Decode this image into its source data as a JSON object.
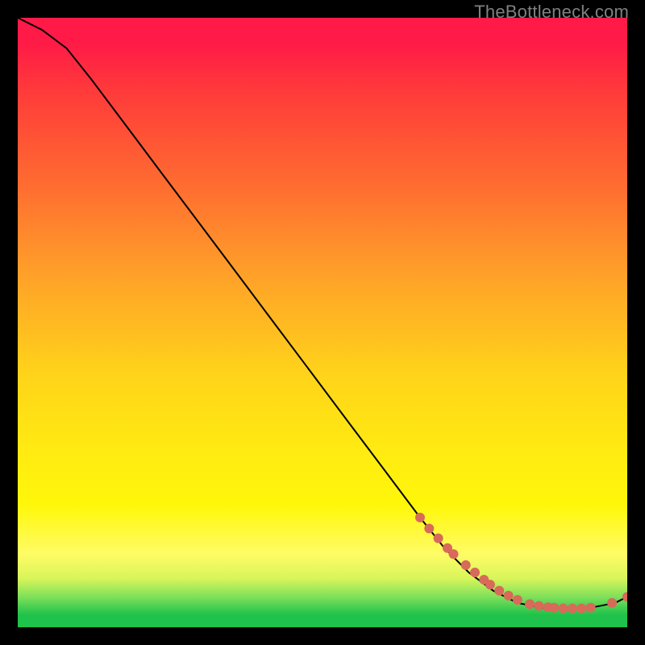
{
  "watermark": "TheBottleneck.com",
  "chart_data": {
    "type": "line",
    "title": "",
    "xlabel": "",
    "ylabel": "",
    "xlim": [
      0,
      100
    ],
    "ylim": [
      0,
      100
    ],
    "grid": false,
    "series": [
      {
        "name": "curve",
        "color": "#000000",
        "x": [
          0,
          4,
          8,
          12,
          18,
          24,
          30,
          36,
          42,
          48,
          54,
          60,
          66,
          70,
          74,
          78,
          82,
          86,
          90,
          94,
          98,
          100
        ],
        "y": [
          100,
          98,
          95,
          90,
          82,
          74,
          66,
          58,
          50,
          42,
          34,
          26,
          18,
          13,
          9,
          6,
          4,
          3.2,
          3.1,
          3.2,
          4.0,
          5.0
        ]
      },
      {
        "name": "markers",
        "color": "#d86a5a",
        "type": "scatter",
        "x": [
          66,
          67.5,
          69,
          70.5,
          71.5,
          73.5,
          75,
          76.5,
          77.5,
          79,
          80.5,
          82,
          84,
          85.5,
          87,
          88,
          89.5,
          91,
          92.5,
          94,
          97.5,
          100
        ],
        "y": [
          18,
          16.2,
          14.6,
          13,
          12,
          10.2,
          9,
          7.8,
          7,
          6,
          5.2,
          4.5,
          3.8,
          3.5,
          3.3,
          3.2,
          3.1,
          3.1,
          3.1,
          3.2,
          4.0,
          5.0
        ]
      }
    ]
  }
}
